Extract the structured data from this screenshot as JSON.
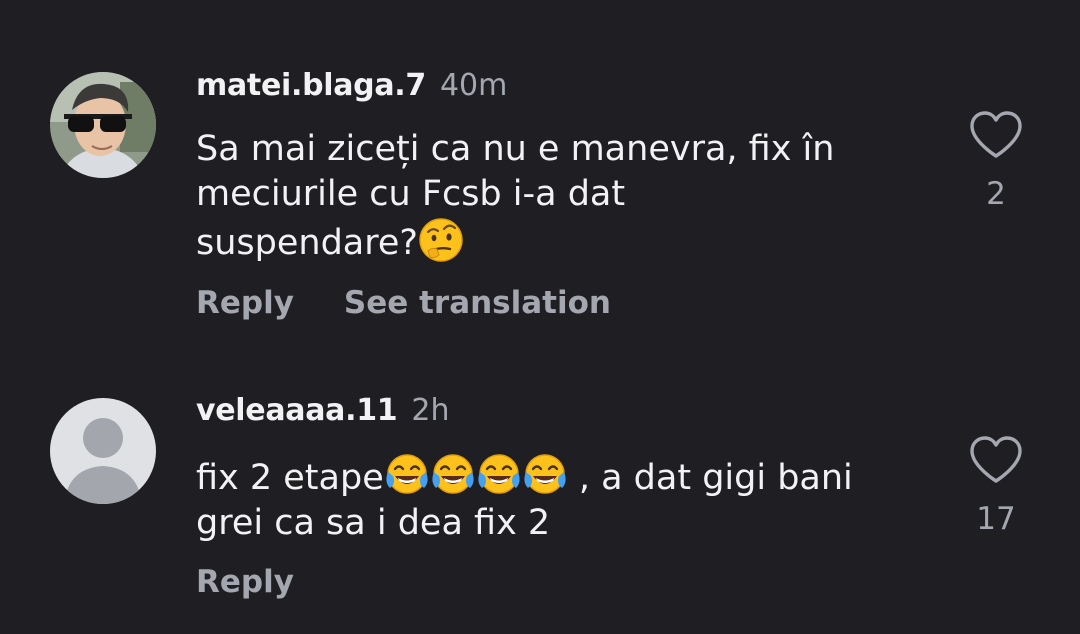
{
  "comments": [
    {
      "username": "matei.blaga.7",
      "time": "40m",
      "text_line1": "Sa mai ziceți ca nu e manevra, fix în",
      "text_line2": "meciurile cu Fcsb i-a dat",
      "text_line3": "suspendare?",
      "emoji": "face-with-raised-eyebrow-icon",
      "reply_label": "Reply",
      "translate_label": "See translation",
      "likes": "2"
    },
    {
      "username": "veleaaaa.11",
      "time": "2h",
      "text_line1_start": "fix 2 etape",
      "emojis": [
        "face-with-tears-of-joy-icon",
        "face-with-tears-of-joy-icon",
        "face-with-tears-of-joy-icon",
        "face-with-tears-of-joy-icon"
      ],
      "text_line1_end": " , a dat gigi bani",
      "text_line2": "grei ca sa i dea fix 2",
      "reply_label": "Reply",
      "likes": "17"
    }
  ],
  "colors": {
    "background": "#1f1f23",
    "primary_text": "#f2f2f4",
    "secondary_text": "#a4a7b0"
  }
}
